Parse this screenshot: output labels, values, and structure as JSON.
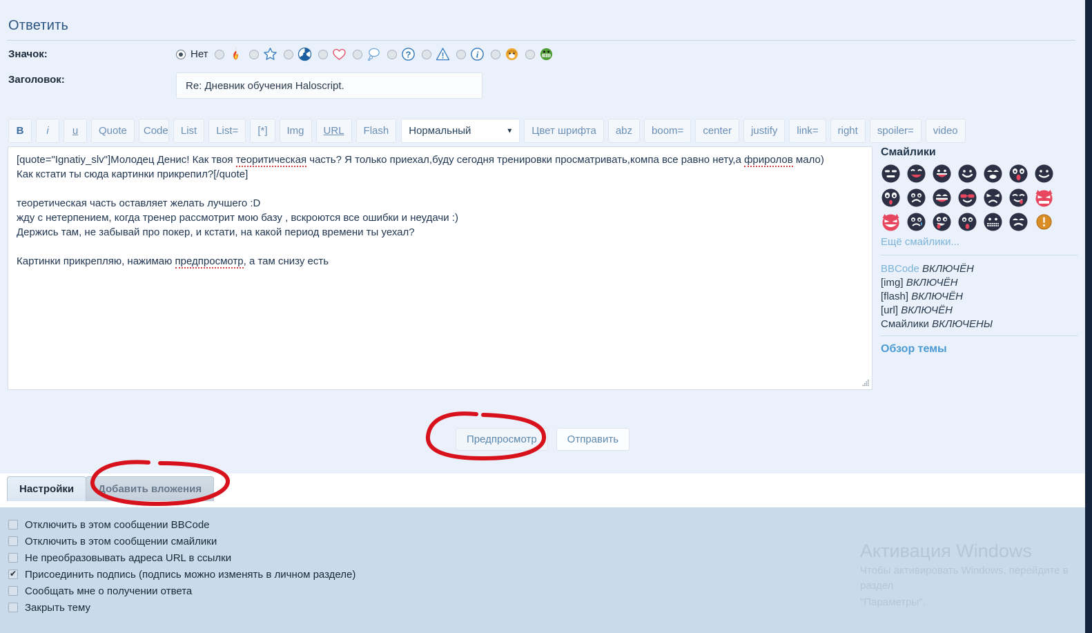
{
  "page": {
    "title": "Ответить"
  },
  "icon_field": {
    "label": "Значок:",
    "none_label": "Нет",
    "options": [
      {
        "name": "no-icon",
        "selected": true
      },
      {
        "name": "fire-icon",
        "selected": false
      },
      {
        "name": "star-icon",
        "selected": false
      },
      {
        "name": "radioactive-icon",
        "selected": false
      },
      {
        "name": "heart-icon",
        "selected": false
      },
      {
        "name": "thought-bubble-icon",
        "selected": false
      },
      {
        "name": "question-icon",
        "selected": false
      },
      {
        "name": "warning-icon",
        "selected": false
      },
      {
        "name": "info-icon",
        "selected": false
      },
      {
        "name": "smiley-orange-icon",
        "selected": false
      },
      {
        "name": "smiley-green-icon",
        "selected": false
      }
    ]
  },
  "subject_field": {
    "label": "Заголовок:",
    "value": "Re: Дневник обучения Haloscript.",
    "placeholder": ""
  },
  "toolbar": {
    "buttons": [
      {
        "label": "B",
        "style": "bold"
      },
      {
        "label": "i",
        "style": "italic"
      },
      {
        "label": "u",
        "style": "under"
      },
      {
        "label": "Quote",
        "style": ""
      },
      {
        "label": "Code",
        "style": "clip"
      },
      {
        "label": "List",
        "style": ""
      },
      {
        "label": "List=",
        "style": ""
      },
      {
        "label": "[*]",
        "style": ""
      },
      {
        "label": "Img",
        "style": ""
      },
      {
        "label": "URL",
        "style": "under"
      },
      {
        "label": "Flash",
        "style": ""
      }
    ],
    "font_size_selected": "Нормальный",
    "buttons2": [
      {
        "label": "Цвет шрифта"
      },
      {
        "label": "abz"
      },
      {
        "label": "boom="
      },
      {
        "label": "center"
      },
      {
        "label": "justify"
      },
      {
        "label": "link="
      },
      {
        "label": "right"
      },
      {
        "label": "spoiler="
      },
      {
        "label": "video"
      }
    ]
  },
  "editor": {
    "line1a": "[quote=\"Ignatiy_slv\"]Молодец Денис! Как твоя ",
    "line1_err1": "теоритическая",
    "line1b": " часть? Я только приехал,буду сегодня тренировки просматривать,компа все равно нету,а ",
    "line2_err": "фриролов",
    "line2b": " мало)",
    "line3": "Как кстати ты сюда картинки прикрепил?[/quote]",
    "line4": "",
    "line5": "теоретическая часть оставляет желать лучшего :D",
    "line6": "жду с нетерпением, когда тренер рассмотрит мою базу , вскроются все ошибки и неудачи :)",
    "line7": "Держись там, не забывай про покер, и кстати, на какой период времени ты уехал?",
    "line8": "",
    "line9a": "Картинки прикрепляю, нажимаю ",
    "line9_err": "предпросмотр",
    "line9b": ", а там снизу есть"
  },
  "sidebar": {
    "smileys_heading": "Смайлики",
    "smileys": [
      {
        "name": "smiley-cool"
      },
      {
        "name": "smiley-laugh"
      },
      {
        "name": "smiley-grin"
      },
      {
        "name": "smiley-happy"
      },
      {
        "name": "smiley-surprised"
      },
      {
        "name": "smiley-tongue-red"
      },
      {
        "name": "smiley-wink"
      },
      {
        "name": "smiley-crazy"
      },
      {
        "name": "smiley-sad"
      },
      {
        "name": "smiley-shout"
      },
      {
        "name": "smiley-sunglasses"
      },
      {
        "name": "smiley-angry"
      },
      {
        "name": "smiley-lick"
      },
      {
        "name": "devil-red-angry"
      },
      {
        "name": "devil-red-grin"
      },
      {
        "name": "smiley-cry"
      },
      {
        "name": "smiley-drool"
      },
      {
        "name": "smiley-tongue-out"
      },
      {
        "name": "smiley-teeth"
      },
      {
        "name": "smiley-shocked"
      },
      {
        "name": "exclamation-orange"
      }
    ],
    "more_smileys": "Ещё смайлики...",
    "bbcode_lines": [
      {
        "tag": "BBCode",
        "state": "ВКЛЮЧЁН"
      },
      {
        "tag": "[img]",
        "state": "ВКЛЮЧЁН"
      },
      {
        "tag": "[flash]",
        "state": "ВКЛЮЧЁН"
      },
      {
        "tag": "[url]",
        "state": "ВКЛЮЧЁН"
      },
      {
        "tag": "Смайлики",
        "state": "ВКЛЮЧЕНЫ"
      }
    ],
    "topic_review": "Обзор темы"
  },
  "actions": {
    "preview": "Предпросмотр",
    "submit": "Отправить"
  },
  "tabs": [
    {
      "label": "Настройки",
      "active": true
    },
    {
      "label": "Добавить вложения",
      "active": false
    }
  ],
  "options": [
    {
      "label": "Отключить в этом сообщении BBCode",
      "checked": false
    },
    {
      "label": "Отключить в этом сообщении смайлики",
      "checked": false
    },
    {
      "label": "Не преобразовывать адреса URL в ссылки",
      "checked": false
    },
    {
      "label": "Присоединить подпись (подпись можно изменять в личном разделе)",
      "checked": true
    },
    {
      "label": "Сообщать мне о получении ответа",
      "checked": false
    },
    {
      "label": "Закрыть тему",
      "checked": false
    }
  ],
  "watermark": {
    "title": "Активация Windows",
    "line1": "Чтобы активировать Windows, перейдите в раздел",
    "line2": "\"Параметры\"."
  },
  "colors": {
    "panel_bg": "#eaf1fb",
    "lower_bg": "#c9dbeb",
    "accent_link": "#4b9ad4",
    "annotation_red": "#d8121c",
    "title_blue": "#2b5480"
  }
}
